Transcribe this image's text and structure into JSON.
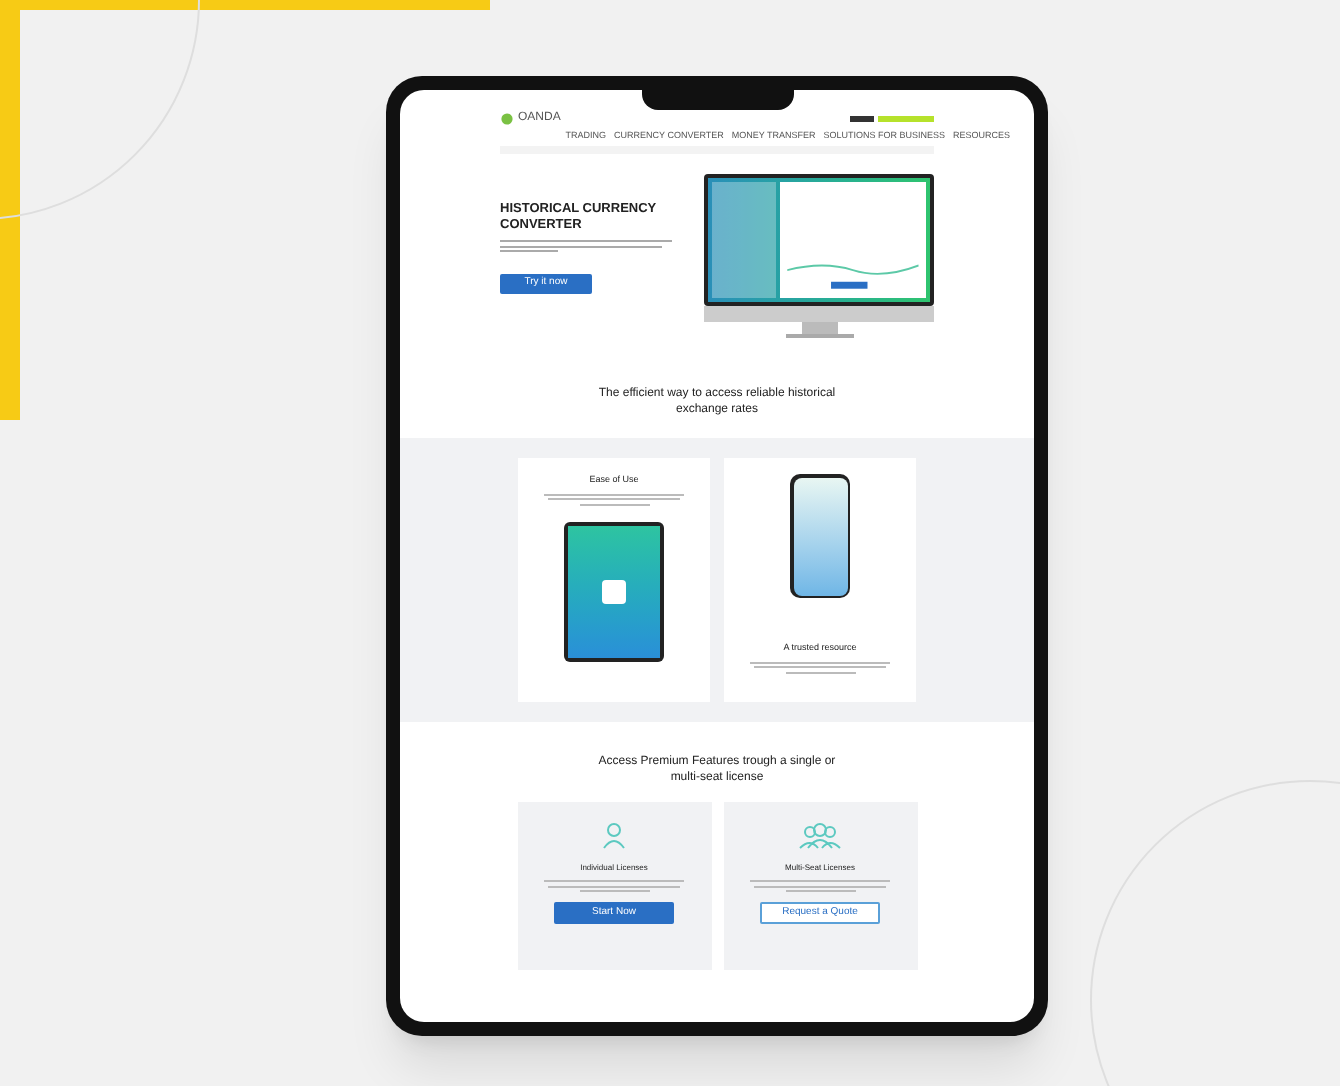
{
  "header": {
    "logo": "OANDA",
    "nav": [
      "TRADING",
      "CURRENCY CONVERTER",
      "MONEY TRANSFER",
      "SOLUTIONS FOR BUSINESS",
      "RESOURCES"
    ]
  },
  "hero": {
    "title": "HISTORICAL CURRENCY CONVERTER",
    "button": "Try it now"
  },
  "features_heading": "The efficient way to access reliable historical exchange rates",
  "features": [
    {
      "kind": "tablet",
      "title": "Ease of Use"
    },
    {
      "kind": "phone",
      "title": "A trusted resource"
    }
  ],
  "licenses_heading": "Access Premium Features trough a single or multi-seat license",
  "licenses": [
    {
      "kind": "primary",
      "title": "Individual Licenses",
      "button": "Start Now"
    },
    {
      "kind": "outline",
      "title": "Multi-Seat Licenses",
      "button": "Request a Quote"
    }
  ]
}
